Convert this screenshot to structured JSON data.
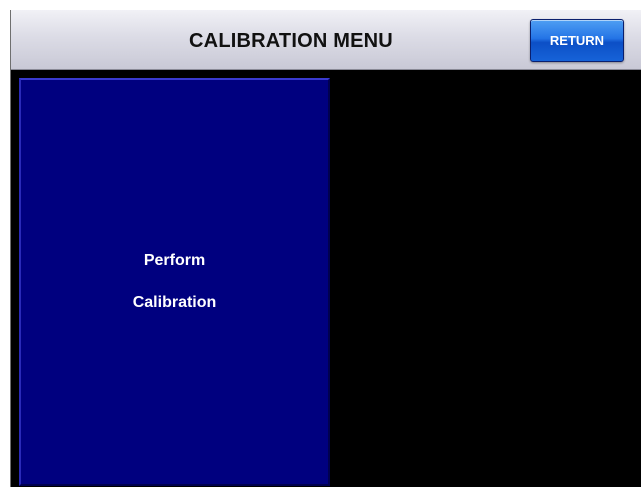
{
  "header": {
    "title": "CALIBRATION MENU",
    "return_label": "RETURN"
  },
  "main": {
    "calibrate_button": {
      "line1": "Perform",
      "line2": "Calibration"
    }
  },
  "colors": {
    "screen_background": "#000000",
    "header_background": "#dcdce6",
    "return_button": "#1663d8",
    "calibrate_button": "#00007f",
    "button_text": "#ffffff"
  }
}
